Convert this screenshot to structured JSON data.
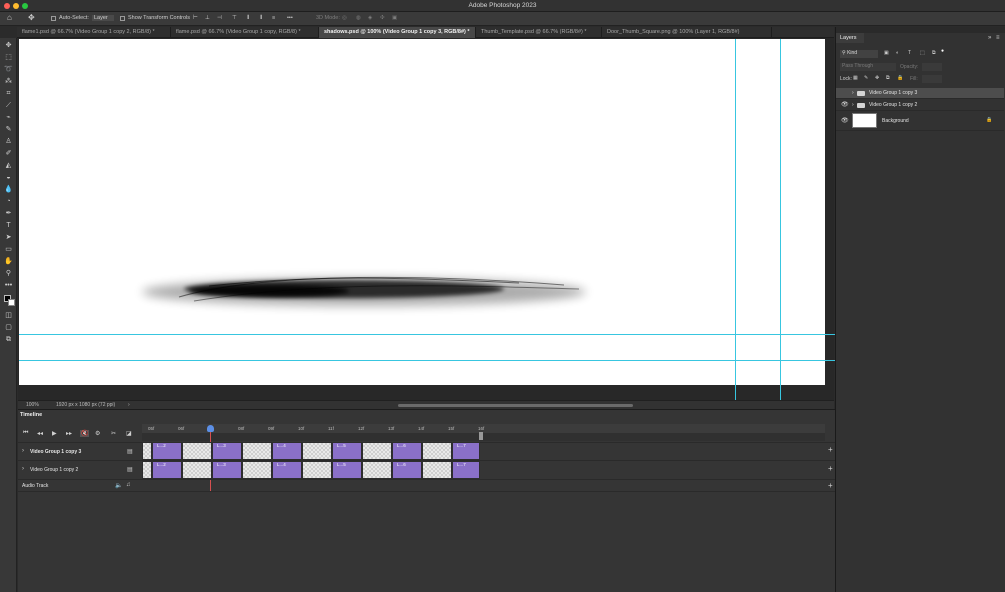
{
  "app": {
    "title": "Adobe Photoshop 2023"
  },
  "options": {
    "auto_select_label": "Auto-Select:",
    "auto_select_value": "Layer",
    "show_transform_label": "Show Transform Controls",
    "mode_3d_label": "3D Mode:"
  },
  "tabs": [
    {
      "label": "flame1.psd @ 66.7% (Video Group 1 copy 2, RGB/8) *"
    },
    {
      "label": "flame.psd @ 66.7% (Video Group 1 copy, RGB/8) *"
    },
    {
      "label": "shadows.psd @ 100% (Video Group 1 copy 3, RGB/8#) *"
    },
    {
      "label": "Thumb_Template.psd @ 66.7% (RGB/8#) *"
    },
    {
      "label": "Door_Thumb_Square.png @ 100% (Layer 1, RGB/8#)"
    }
  ],
  "status": {
    "zoom": "100%",
    "doc_info": "1920 px x 1080 px (72 ppi)"
  },
  "layers_panel": {
    "title": "Layers",
    "filter_label": "Kind",
    "blend_mode": "Pass Through",
    "opacity_label": "Opacity:",
    "lock_label": "Lock:",
    "fill_label": "Fill:",
    "layers": [
      {
        "name": "Video Group 1 copy 3",
        "visible": false,
        "type": "group",
        "selected": true
      },
      {
        "name": "Video Group 1 copy 2",
        "visible": true,
        "type": "group",
        "selected": false
      },
      {
        "name": "Background",
        "visible": true,
        "type": "pixel",
        "selected": false,
        "locked": true
      }
    ]
  },
  "timeline": {
    "title": "Timeline",
    "ruler_ticks": [
      "05f",
      "06f",
      "08f",
      "09f",
      "10f",
      "11f",
      "12f",
      "13f",
      "14f",
      "15f",
      "16f"
    ],
    "tracks": [
      {
        "name": "Video Group 1 copy 3"
      },
      {
        "name": "Video Group 1 copy 2"
      },
      {
        "name": "Audio Track"
      }
    ],
    "clip_labels": [
      "L...2",
      "L...3",
      "L...4",
      "L...5",
      "L...6",
      "L...7"
    ]
  },
  "colors": {
    "accent_guide": "#38c6e0",
    "clip_purple": "#8a70c8"
  }
}
